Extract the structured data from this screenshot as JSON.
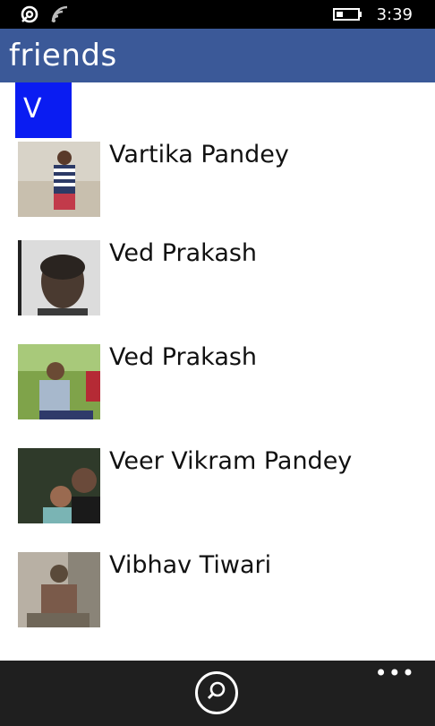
{
  "status_bar": {
    "time": "3:39",
    "icons": [
      "notification-icon",
      "wifi-icon",
      "battery-icon"
    ]
  },
  "header": {
    "title": "friends",
    "color": "#3b5998"
  },
  "list": {
    "group_letter": "V",
    "group_color": "#0a1cf2",
    "contacts": [
      {
        "name": "Vartika Pandey"
      },
      {
        "name": "Ved Prakash"
      },
      {
        "name": "Ved Prakash"
      },
      {
        "name": "Veer Vikram Pandey"
      },
      {
        "name": "Vibhav Tiwari"
      }
    ]
  },
  "app_bar": {
    "icons": [
      "search-icon",
      "more-icon"
    ],
    "more_label": "•••"
  }
}
